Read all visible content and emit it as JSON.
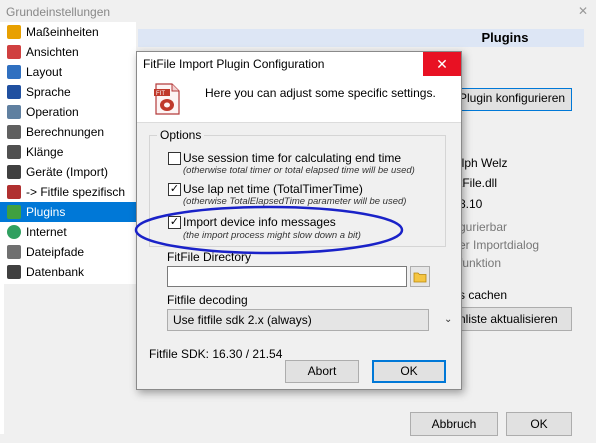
{
  "parent_window": {
    "title": "Grundeinstellungen",
    "close_glyph": "✕",
    "sidebar": {
      "items": [
        {
          "label": "Maßeinheiten",
          "icon": "ruler-icon",
          "color": "#e8a000"
        },
        {
          "label": "Ansichten",
          "icon": "windows-icon",
          "color": "#d04040"
        },
        {
          "label": "Layout",
          "icon": "layout-icon",
          "color": "#3070c0"
        },
        {
          "label": "Sprache",
          "icon": "globe-flag-icon",
          "color": "#2050a0"
        },
        {
          "label": "Operation",
          "icon": "wrench-icon",
          "color": "#6080a0"
        },
        {
          "label": "Berechnungen",
          "icon": "calculator-icon",
          "color": "#606060"
        },
        {
          "label": "Klänge",
          "icon": "speaker-icon",
          "color": "#505050"
        },
        {
          "label": "Geräte (Import)",
          "icon": "device-icon",
          "color": "#404040"
        },
        {
          "label": "-> Fitfile spezifisch",
          "icon": "fitfile-icon",
          "color": "#b03030"
        },
        {
          "label": "Plugins",
          "icon": "puzzle-icon",
          "color": "#40a040",
          "selected": true
        },
        {
          "label": "Internet",
          "icon": "internet-icon",
          "color": "#30a060"
        },
        {
          "label": "Dateipfade",
          "icon": "document-icon",
          "color": "#707070"
        },
        {
          "label": "Datenbank",
          "icon": "database-icon",
          "color": "#404040"
        }
      ]
    },
    "panel_header": "Plugins",
    "bg_texts": {
      "configure_button": "Plugin konfigurieren",
      "author": "alph Welz",
      "dll": "tFile.dll",
      "version": "8.10",
      "gray1": "gurierbar",
      "gray2": "er Importdialog",
      "gray3": "funktion",
      "cache": "s cachen",
      "update_button": "nliste aktualisieren",
      "cancel_button": "Abbruch",
      "ok_button": "OK"
    }
  },
  "dialog": {
    "title": "FitFile Import Plugin Configuration",
    "close_glyph": "✕",
    "subtitle": "Here you can adjust some specific settings.",
    "options_legend": "Options",
    "options": [
      {
        "label": "Use session time for calculating end time",
        "hint": "(otherwise total timer or total elapsed time will be used)",
        "checked": false,
        "check_glyph": ""
      },
      {
        "label": "Use lap net time (TotalTimerTime)",
        "hint": "(otherwise TotalElapsedTime parameter will be used)",
        "checked": true,
        "check_glyph": "✓"
      },
      {
        "label": "Import device info messages",
        "hint": "(the import process might slow down a bit)",
        "checked": true,
        "check_glyph": "✓"
      }
    ],
    "directory_label": "FitFile Directory",
    "directory_value": "",
    "decoding_label": "Fitfile decoding",
    "decoding_selected": "Use fitfile sdk 2.x (always)",
    "sdk_label": "Fitfile SDK: 16.30 / 21.54",
    "abort_button": "Abort",
    "ok_button": "OK",
    "annotation_color": "#1a22c8"
  }
}
